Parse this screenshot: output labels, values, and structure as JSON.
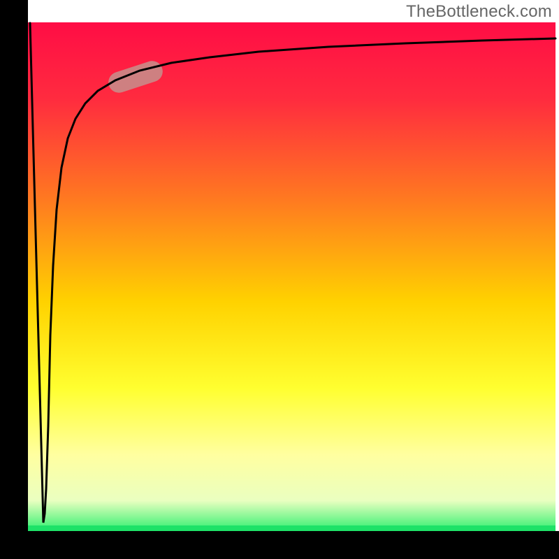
{
  "watermark": "TheBottleneck.com",
  "colors": {
    "top": "#ff0040",
    "mid_upper": "#ff8000",
    "mid": "#ffe000",
    "mid_lower": "#ffff80",
    "bottom": "#30f070",
    "frame": "#000000",
    "curve": "#000000",
    "highlight": "#c98b88"
  },
  "chart_data": {
    "type": "line",
    "title": "",
    "xlabel": "",
    "ylabel": "",
    "xlim": [
      0,
      100
    ],
    "ylim": [
      0,
      100
    ],
    "series": [
      {
        "name": "curve",
        "x": [
          0,
          2.5,
          3.0,
          3.5,
          4.0,
          4.5,
          5.0,
          6.0,
          7.0,
          8.0,
          9.0,
          10.0,
          12.0,
          15.0,
          20.0,
          25.0,
          30.0,
          40.0,
          55.0,
          70.0,
          85.0,
          100.0
        ],
        "y": [
          100,
          0,
          2,
          10,
          25,
          40,
          52,
          66,
          73,
          78,
          81,
          83,
          86,
          88,
          90,
          91.5,
          92.5,
          93.5,
          94.5,
          95,
          95.3,
          95.6
        ]
      }
    ],
    "annotations": [
      {
        "name": "highlight-segment",
        "x_range": [
          15,
          24
        ],
        "y_range": [
          88,
          91
        ]
      }
    ],
    "legend_position": "none",
    "grid": false
  }
}
